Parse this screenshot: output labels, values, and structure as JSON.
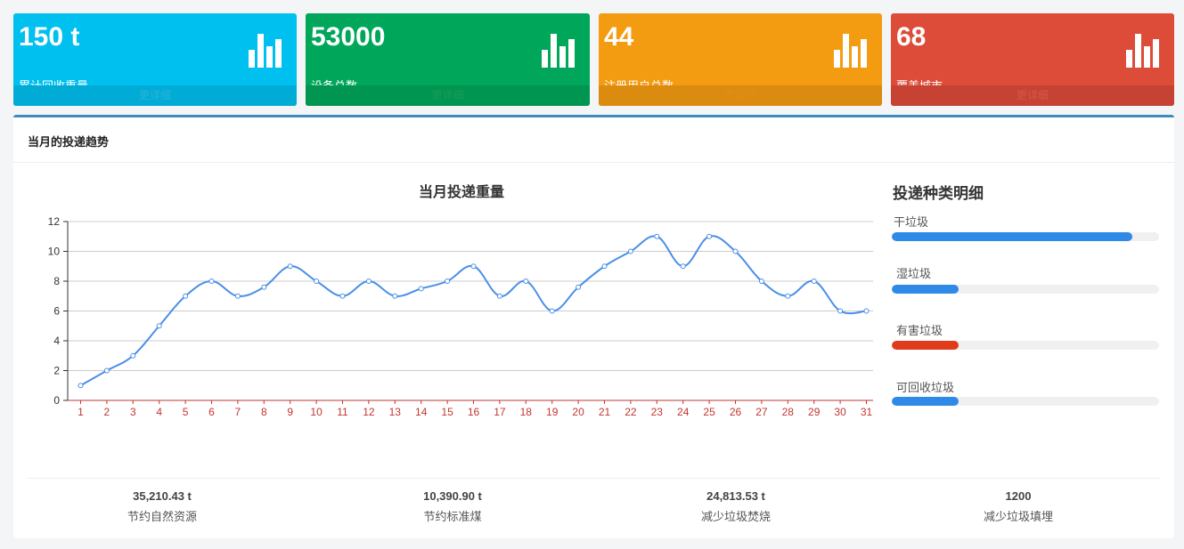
{
  "stats": [
    {
      "value": "150 t",
      "label": "累计回收重量",
      "link": "更详细",
      "icon": "bar-chart-icon"
    },
    {
      "value": "53000",
      "label": "设备总数",
      "link": "更详细",
      "icon": "bar-chart-icon"
    },
    {
      "value": "44",
      "label": "注册用户总数",
      "link": "更详细",
      "icon": "bar-chart-icon"
    },
    {
      "value": "68",
      "label": "覆盖城市",
      "link": "更详细",
      "icon": "bar-chart-icon"
    }
  ],
  "colors": {
    "accent": "#3c8dbc",
    "line": "#4a8fe7",
    "bar_blue": "#2f89e6",
    "bar_red": "#e03c1c",
    "axis_label": "#c23531"
  },
  "panel": {
    "title": "当月的投递趋势"
  },
  "chart_data": {
    "type": "line",
    "title": "当月投递重量",
    "xlabel": "",
    "ylabel": "",
    "categories": [
      "1",
      "2",
      "3",
      "4",
      "5",
      "6",
      "7",
      "8",
      "9",
      "10",
      "11",
      "12",
      "13",
      "14",
      "15",
      "16",
      "17",
      "18",
      "19",
      "20",
      "21",
      "22",
      "23",
      "24",
      "25",
      "26",
      "27",
      "28",
      "29",
      "30",
      "31"
    ],
    "values": [
      1,
      2,
      3,
      5,
      7,
      8,
      7,
      7.6,
      9,
      8,
      7,
      8,
      7,
      7.5,
      8,
      9,
      7,
      8,
      6,
      7.6,
      9,
      10,
      11,
      9,
      11,
      10,
      8,
      7,
      8,
      6,
      6
    ],
    "ylim": [
      0,
      12
    ],
    "yticks": [
      0,
      2,
      4,
      6,
      8,
      10,
      12
    ],
    "grid": true,
    "smooth": true
  },
  "detail": {
    "title": "投递种类明细",
    "items": [
      {
        "label": "干垃圾",
        "percent": 90,
        "color": "#2f89e6"
      },
      {
        "label": "湿垃圾",
        "percent": 25,
        "color": "#2f89e6"
      },
      {
        "label": "有害垃圾",
        "percent": 25,
        "color": "#e03c1c"
      },
      {
        "label": "可回收垃圾",
        "percent": 25,
        "color": "#2f89e6"
      }
    ]
  },
  "summary": [
    {
      "value": "35,210.43 t",
      "label": "节约自然资源"
    },
    {
      "value": "10,390.90 t",
      "label": "节约标准煤"
    },
    {
      "value": "24,813.53 t",
      "label": "减少垃圾焚烧"
    },
    {
      "value": "1200",
      "label": "减少垃圾填埋"
    }
  ]
}
